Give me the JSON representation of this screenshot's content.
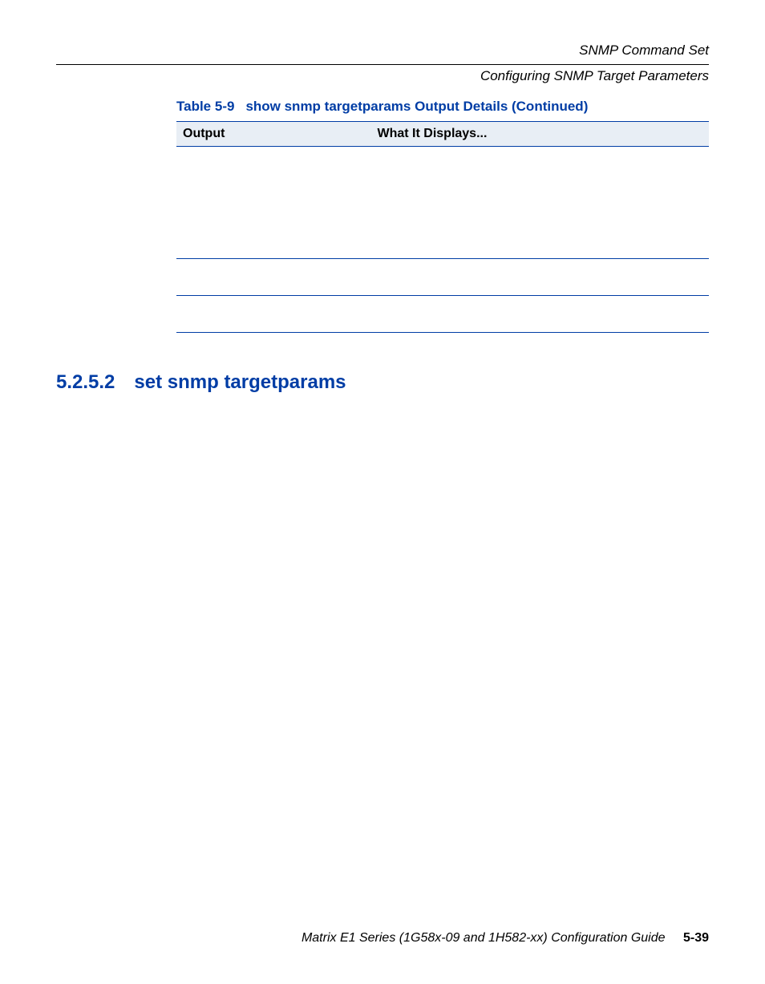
{
  "header": {
    "line1": "SNMP Command Set",
    "line2": "Configuring SNMP Target Parameters"
  },
  "table": {
    "caption_label": "Table 5-9",
    "caption_title": "show snmp targetparams Output Details (Continued)",
    "col1": "Output",
    "col2": "What It Displays..."
  },
  "section": {
    "number": "5.2.5.2",
    "title": "set snmp targetparams"
  },
  "footer": {
    "text": "Matrix E1 Series (1G58x-09 and 1H582-xx) Configuration Guide",
    "page": "5-39"
  }
}
